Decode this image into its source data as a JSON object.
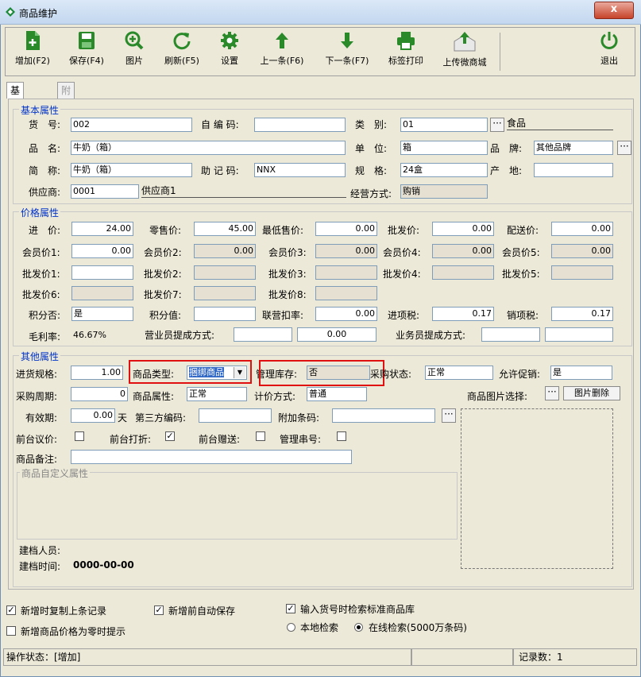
{
  "window": {
    "title": "商品维护",
    "close_label": "x"
  },
  "toolbar": {
    "add": "增加(F2)",
    "save": "保存(F4)",
    "image": "图片",
    "refresh": "刷新(F5)",
    "settings": "设置",
    "prev": "上一条(F6)",
    "next": "下一条(F7)",
    "print_label": "标签打印",
    "upload": "上传微商城",
    "exit": "退出"
  },
  "tabs": {
    "basic": "基础信息",
    "extra": "附加信息"
  },
  "basic": {
    "title": "基本属性",
    "code_label": "货　号:",
    "code": "002",
    "self_code_label": "自 编 码:",
    "self_code": "",
    "category_label": "类　别:",
    "category": "01",
    "category_name": "食品",
    "name_label": "品　名:",
    "name": "牛奶（箱）",
    "unit_label": "单　位:",
    "unit": "箱",
    "brand_label": "品　牌:",
    "brand": "其他品牌",
    "short_label": "简　称:",
    "short": "牛奶（箱）",
    "mnemonic_label": "助 记 码:",
    "mnemonic": "NNX",
    "spec_label": "规　格:",
    "spec": "24盒",
    "origin_label": "产　地:",
    "origin": "",
    "supplier_label": "供应商:",
    "supplier": "0001",
    "supplier_name": "供应商1",
    "mode_label": "经营方式:",
    "mode": "购销",
    "more": "···"
  },
  "price": {
    "title": "价格属性",
    "purchase_label": "进　价:",
    "purchase": "24.00",
    "retail_label": "零售价:",
    "retail": "45.00",
    "min_label": "最低售价:",
    "min": "0.00",
    "wholesale_label": "批发价:",
    "wholesale": "0.00",
    "dist_label": "配送价:",
    "dist": "0.00",
    "m1_label": "会员价1:",
    "m1": "0.00",
    "m2_label": "会员价2:",
    "m2": "0.00",
    "m3_label": "会员价3:",
    "m3": "0.00",
    "m4_label": "会员价4:",
    "m4": "0.00",
    "m5_label": "会员价5:",
    "m5": "0.00",
    "w1_label": "批发价1:",
    "w2_label": "批发价2:",
    "w3_label": "批发价3:",
    "w4_label": "批发价4:",
    "w5_label": "批发价5:",
    "w6_label": "批发价6:",
    "w7_label": "批发价7:",
    "w8_label": "批发价8:",
    "points_label": "积分否:",
    "points": "是",
    "points_val_label": "积分值:",
    "points_val": "",
    "joint_label": "联营扣率:",
    "joint": "0.00",
    "in_tax_label": "进项税:",
    "in_tax": "0.17",
    "out_tax_label": "销项税:",
    "out_tax": "0.17",
    "margin_label": "毛利率:",
    "margin": "46.67%",
    "clerk_comm_label": "营业员提成方式:",
    "clerk_comm": "0.00",
    "sales_comm_label": "业务员提成方式:"
  },
  "other": {
    "title": "其他属性",
    "pack_label": "进货规格:",
    "pack": "1.00",
    "type_label": "商品类型:",
    "type": "捆绑商品",
    "stock_label": "管理库存:",
    "stock": "否",
    "purchase_state_label": "采购状态:",
    "purchase_state": "正常",
    "promo_label": "允许促销:",
    "promo": "是",
    "cycle_label": "采购周期:",
    "cycle": "0",
    "attr_label": "商品属性:",
    "attr": "正常",
    "pricing_label": "计价方式:",
    "pricing": "普通",
    "image_select_label": "商品图片选择:",
    "image_delete": "图片删除",
    "expiry_label": "有效期:",
    "expiry": "0.00",
    "days": "天",
    "third_code_label": "第三方编码:",
    "third_code": "",
    "extra_barcode_label": "附加条码:",
    "extra_barcode": "",
    "negotiate_label": "前台议价:",
    "discount_label": "前台打折:",
    "gift_label": "前台赠送:",
    "serial_label": "管理串号:",
    "remark_label": "商品备注:",
    "remark": "",
    "custom_title": "商品自定义属性",
    "creator_label": "建档人员:",
    "created_label": "建档时间:",
    "created": "0000-00-00"
  },
  "options": {
    "copy_last": "新增时复制上条记录",
    "auto_save": "新增前自动保存",
    "search_std": "输入货号时检索标准商品库",
    "price_zero": "新增商品价格为零时提示",
    "local": "本地检索",
    "online": "在线检索(5000万条码)"
  },
  "statusbar": {
    "state": "操作状态：[增加]",
    "count": "记录数：1"
  },
  "colors": {
    "accent_green": "#2a8a2a",
    "highlight_red": "#e01010",
    "group_title": "#0033cc"
  }
}
